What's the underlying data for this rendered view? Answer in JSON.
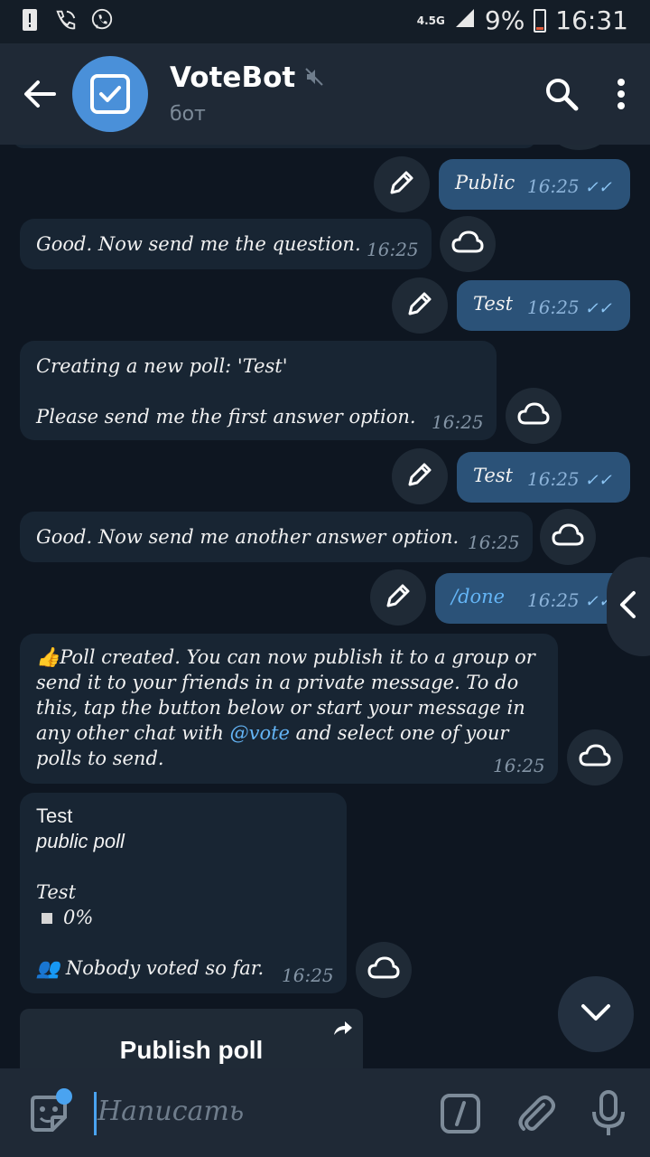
{
  "status_bar": {
    "network": "4.5G",
    "battery": "9%",
    "time": "16:31"
  },
  "header": {
    "title": "VoteBot",
    "subtitle": "бот"
  },
  "messages": [
    {
      "from": "me",
      "text": "Public",
      "time": "16:25"
    },
    {
      "from": "bot",
      "text": "Good. Now send me the question.",
      "time": "16:25"
    },
    {
      "from": "me",
      "text": "Test",
      "time": "16:25"
    },
    {
      "from": "bot",
      "line1": "Creating a new poll: 'Test'",
      "line2": "Please send me the first answer option.",
      "time": "16:25"
    },
    {
      "from": "me",
      "text": "Test",
      "time": "16:25"
    },
    {
      "from": "bot",
      "text": "Good. Now send me another answer option.",
      "time": "16:25"
    },
    {
      "from": "me",
      "text": "/done",
      "time": "16:25"
    },
    {
      "from": "bot",
      "emoji": "👍",
      "part1": "Poll created. You can now publish it to a group or send it to your friends in a private message. To do this, tap the button below or start your message in any other chat with ",
      "mention": "@vote",
      "part2": " and select one of your polls to send.",
      "time": "16:25"
    },
    {
      "from": "bot",
      "poll_title": "Test",
      "poll_type": "public poll",
      "option": "Test",
      "percent": "0%",
      "footer_emoji": "👥",
      "footer": "Nobody voted so far.",
      "time": "16:25"
    }
  ],
  "inline_button": {
    "label": "Publish poll"
  },
  "composer": {
    "placeholder": "Написать"
  },
  "colors": {
    "background": "#0e1621",
    "header": "#1f2936",
    "incoming": "#182533",
    "outgoing": "#2b5278",
    "accent": "#4aa3f0"
  }
}
